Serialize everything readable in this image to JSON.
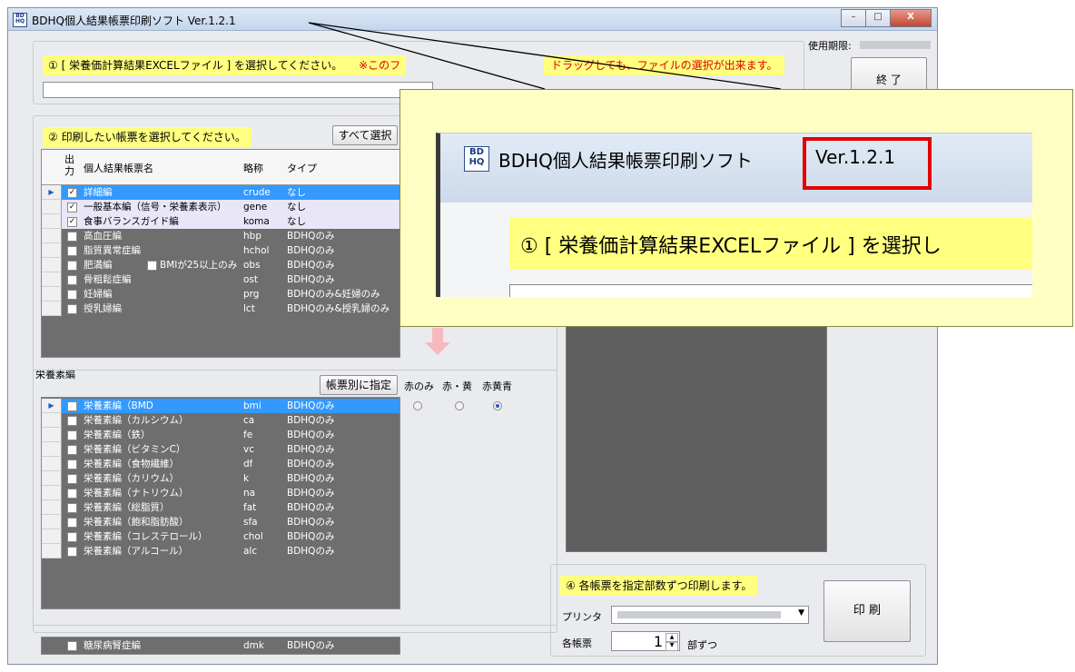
{
  "window": {
    "title": "BDHQ個人結果帳票印刷ソフト  Ver.1.2.1",
    "logo_text": "BD HQ",
    "controls": [
      "–",
      "□",
      "X"
    ]
  },
  "expiry_label": "使用期限:",
  "exit_button": "終 了",
  "step1": {
    "label": "① [ 栄養価計算結果EXCELファイル ] を選択してください。",
    "note": "※このフ",
    "note_tail": "ドラッグしても、ファイルの選択が出来ます。",
    "file_value": ""
  },
  "step2": {
    "label": "② 印刷したい帳票を選択してください。",
    "select_all": "すべて選択",
    "headers": {
      "output": "出力",
      "name": "個人結果帳票名",
      "abbr": "略称",
      "type": "タイプ"
    },
    "rows": [
      {
        "checked": true,
        "name": "詳細編",
        "abbr": "crude",
        "type": "なし",
        "style": "sel"
      },
      {
        "checked": true,
        "name": "一般基本編（信号・栄養素表示）",
        "abbr": "gene",
        "type": "なし",
        "style": "light"
      },
      {
        "checked": true,
        "name": "食事バランスガイド編",
        "abbr": "koma",
        "type": "なし",
        "style": "light"
      },
      {
        "checked": false,
        "name": "高血圧編",
        "abbr": "hbp",
        "type": "BDHQのみ",
        "style": "dark"
      },
      {
        "checked": false,
        "name": "脂質異常症編",
        "abbr": "hchol",
        "type": "BDHQのみ",
        "style": "dark"
      },
      {
        "checked": false,
        "name": "肥満編",
        "abbr": "obs",
        "type": "BDHQのみ",
        "style": "dark",
        "extra": "BMIが25以上のみ"
      },
      {
        "checked": false,
        "name": "骨粗鬆症編",
        "abbr": "ost",
        "type": "BDHQのみ",
        "style": "dark"
      },
      {
        "checked": false,
        "name": "妊婦編",
        "abbr": "prg",
        "type": "BDHQのみ&妊婦のみ",
        "style": "dark"
      },
      {
        "checked": false,
        "name": "授乳婦編",
        "abbr": "lct",
        "type": "BDHQのみ&授乳婦のみ",
        "style": "dark"
      }
    ]
  },
  "nutrient": {
    "section_label": "栄養素編",
    "specify_button": "帳票別に指定",
    "radio_labels": [
      "赤のみ",
      "赤・黄",
      "赤黄青"
    ],
    "rows": [
      {
        "name": "栄養素編（BMD",
        "abbr": "bmi",
        "type": "BDHQのみ",
        "style": "sel"
      },
      {
        "name": "栄養素編（カルシウム）",
        "abbr": "ca",
        "type": "BDHQのみ",
        "style": "dark"
      },
      {
        "name": "栄養素編（鉄）",
        "abbr": "fe",
        "type": "BDHQのみ",
        "style": "dark"
      },
      {
        "name": "栄養素編（ビタミンC）",
        "abbr": "vc",
        "type": "BDHQのみ",
        "style": "dark"
      },
      {
        "name": "栄養素編（食物繊維）",
        "abbr": "df",
        "type": "BDHQのみ",
        "style": "dark"
      },
      {
        "name": "栄養素編（カリウム）",
        "abbr": "k",
        "type": "BDHQのみ",
        "style": "dark"
      },
      {
        "name": "栄養素編（ナトリウム）",
        "abbr": "na",
        "type": "BDHQのみ",
        "style": "dark"
      },
      {
        "name": "栄養素編（総脂質）",
        "abbr": "fat",
        "type": "BDHQのみ",
        "style": "dark"
      },
      {
        "name": "栄養素編（飽和脂肪酸）",
        "abbr": "sfa",
        "type": "BDHQのみ",
        "style": "dark"
      },
      {
        "name": "栄養素編（コレステロール）",
        "abbr": "chol",
        "type": "BDHQのみ",
        "style": "dark"
      },
      {
        "name": "栄養素編（アルコール）",
        "abbr": "alc",
        "type": "BDHQのみ",
        "style": "dark"
      }
    ],
    "extra_row": {
      "name": "糖尿病腎症編",
      "abbr": "dmk",
      "type": "BDHQのみ"
    }
  },
  "step4": {
    "label": "④ 各帳票を指定部数ずつ印刷します。",
    "printer_label": "プリンタ",
    "copies_label": "各帳票",
    "copies_value": "1",
    "copies_suffix": "部ずつ",
    "print_button": "印 刷"
  },
  "zoom": {
    "title": "BDHQ個人結果帳票印刷ソフト",
    "version": "Ver.1.2.1",
    "label": "① [ 栄養価計算結果EXCELファイル ] を選択し"
  },
  "colors": {
    "highlight": "#ffff80",
    "selected": "#3399ff",
    "callout": "#ffffc4",
    "version_box": "#e00000"
  }
}
